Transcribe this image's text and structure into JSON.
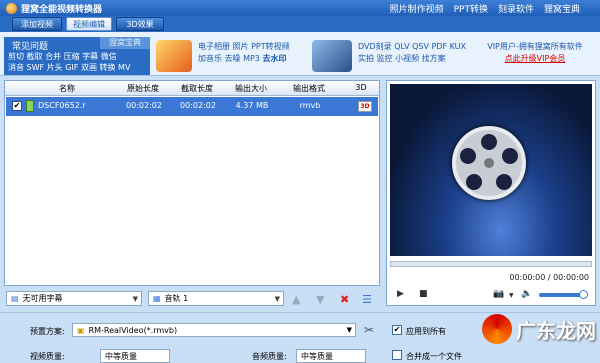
{
  "app": {
    "title": "狸窝全能视频转换器"
  },
  "top_links": [
    "照片制作视频",
    "PPT转换",
    "刻录软件",
    "狸窝宝典"
  ],
  "toolbar": {
    "add_video": "添加视频",
    "edit_video": "视频编辑",
    "effect_3d": "3D效果"
  },
  "faq": {
    "tab1": "常见问题",
    "tab2": "狸窝宝典",
    "links": [
      "剪切",
      "截取",
      "合并",
      "压缩",
      "字幕",
      "微信",
      "消音",
      "SWF",
      "片头",
      "GIF",
      "双画",
      "转换",
      "MV"
    ]
  },
  "promo": {
    "group1_line1": "电子相册  照片  PPT转视频",
    "group1_line2a": "加音乐  去噪  MP3",
    "group1_line2b": "去水印",
    "group2_line1": "DVD刻录  QLV  QSV  PDF  KUX",
    "group2_line2": "实拍  监控  小视频  找方案",
    "vip_line1": "VIP用户-拥有狸窝所有软件",
    "vip_line2": "点此升级VIP会员"
  },
  "table": {
    "headers": [
      "名称",
      "原始长度",
      "截取长度",
      "输出大小",
      "输出格式",
      "3D"
    ],
    "rows": [
      {
        "checked": "✔",
        "name": "DSCF0652.r",
        "original_length": "00:02:02",
        "clip_length": "00:02:02",
        "output_size": "4.37 MB",
        "output_format": "rmvb",
        "badge_3d": "3D"
      }
    ]
  },
  "bottom": {
    "subtitle": "无可用字幕",
    "audio_track": "音轨 1"
  },
  "player": {
    "time": "00:00:00 / 00:00:00"
  },
  "settings": {
    "preset_label": "预置方案:",
    "preset_value": "RM-RealVideo(*.rmvb)",
    "apply_all": "应用到所有",
    "video_quality_label": "视频质量:",
    "video_quality_value": "中等质量",
    "audio_quality_label": "音频质量:",
    "audio_quality_value": "中等质量",
    "merge_label": "合并成一个文件"
  },
  "watermark": {
    "text": "广东龙网"
  }
}
